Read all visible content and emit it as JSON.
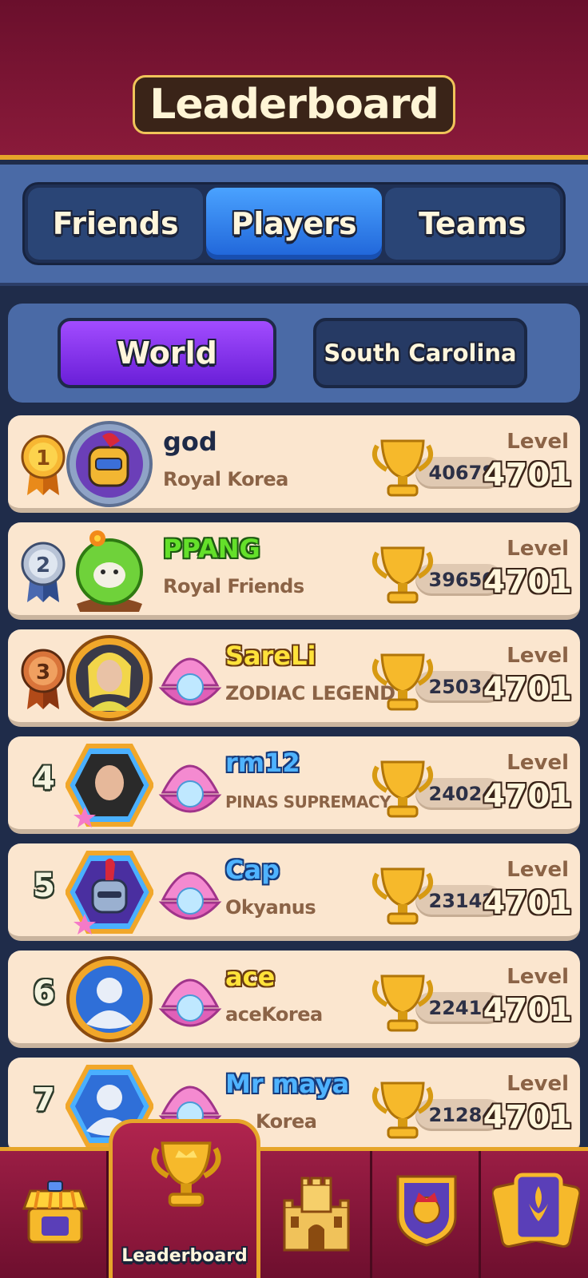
{
  "header": {
    "title": "Leaderboard"
  },
  "tabs": [
    {
      "label": "Friends",
      "active": false
    },
    {
      "label": "Players",
      "active": true
    },
    {
      "label": "Teams",
      "active": false
    }
  ],
  "filters": {
    "world_label": "World",
    "region_label": "South Carolina",
    "selected": "World"
  },
  "level_label": "Level",
  "players": [
    {
      "rank": "1",
      "name": "god",
      "team": "Royal Korea",
      "trophies": "40678",
      "level": "4701",
      "name_color": "#1e2a48"
    },
    {
      "rank": "2",
      "name": "PPANG",
      "team": "Royal Friends",
      "trophies": "39650",
      "level": "4701",
      "name_color": "#64e02a"
    },
    {
      "rank": "3",
      "name": "SareLi",
      "team": "ZODIAC LEGEND",
      "trophies": "25034",
      "level": "4701",
      "name_color": "#ffe23a"
    },
    {
      "rank": "4",
      "name": "rm12",
      "team": "PINAS SUPREMACY",
      "trophies": "24024",
      "level": "4701",
      "name_color": "#4fb3ff"
    },
    {
      "rank": "5",
      "name": "Cap",
      "team": "Okyanus",
      "trophies": "23142",
      "level": "4701",
      "name_color": "#4fb3ff"
    },
    {
      "rank": "6",
      "name": "ace",
      "team": "aceKorea",
      "trophies": "22414",
      "level": "4701",
      "name_color": "#ffe23a"
    },
    {
      "rank": "7",
      "name": "Mr maya",
      "team": "Korea",
      "trophies": "21284",
      "level": "4701",
      "name_color": "#4fb3ff"
    }
  ],
  "bottom_nav": {
    "items": [
      {
        "icon": "shop-icon"
      },
      {
        "icon": "trophy-icon",
        "label": "Leaderboard",
        "active": true
      },
      {
        "icon": "castle-icon"
      },
      {
        "icon": "team-shield-icon"
      },
      {
        "icon": "cards-icon"
      }
    ]
  }
}
